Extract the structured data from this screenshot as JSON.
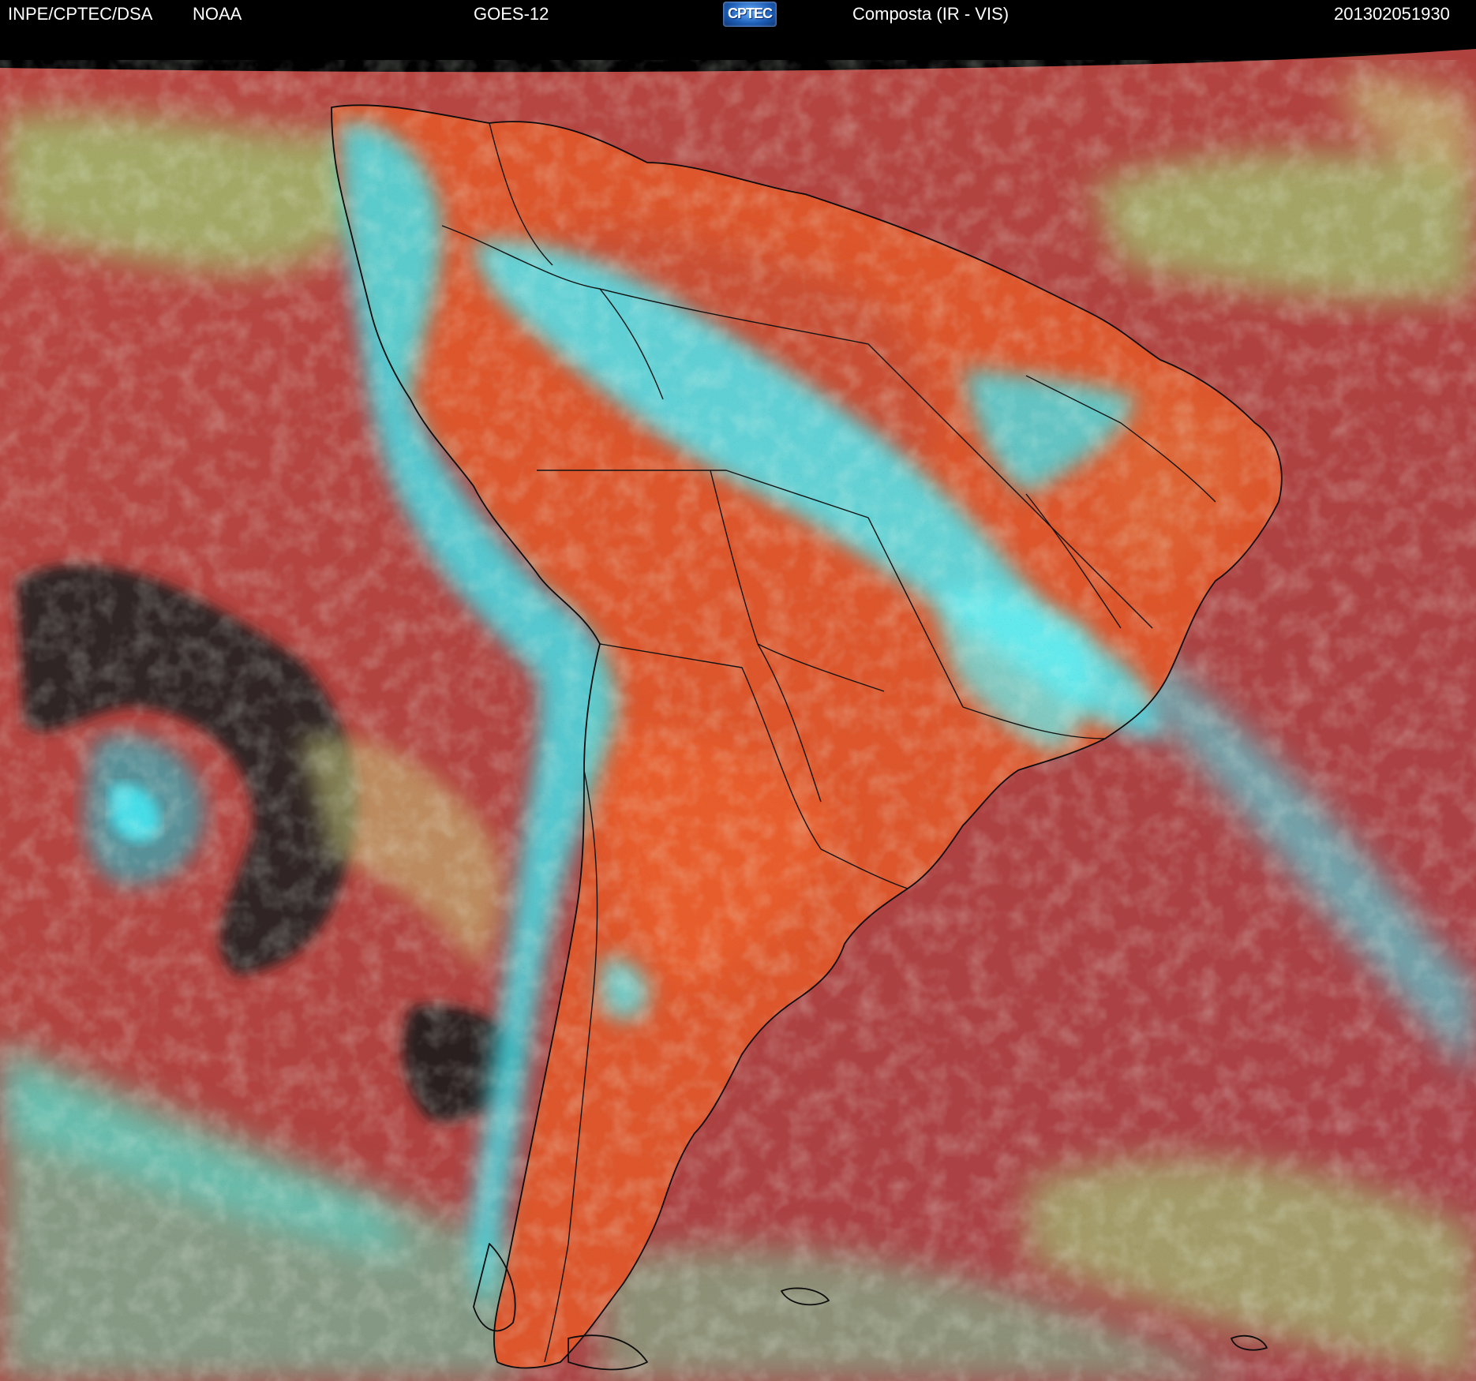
{
  "header": {
    "source": "INPE/CPTEC/DSA",
    "agency": "NOAA",
    "satellite": "GOES-12",
    "logo_text": "CPTEC",
    "product": "Composta (IR - VIS)",
    "timestamp": "201302051930"
  },
  "colors": {
    "background_ocean": "#b3443f",
    "land_clear": "#e3562c",
    "cloud_cold_top": "#35e3ef",
    "cloud_low": "#9bd67a",
    "clear_dry": "#1f1f1f",
    "border_line": "#111111"
  }
}
